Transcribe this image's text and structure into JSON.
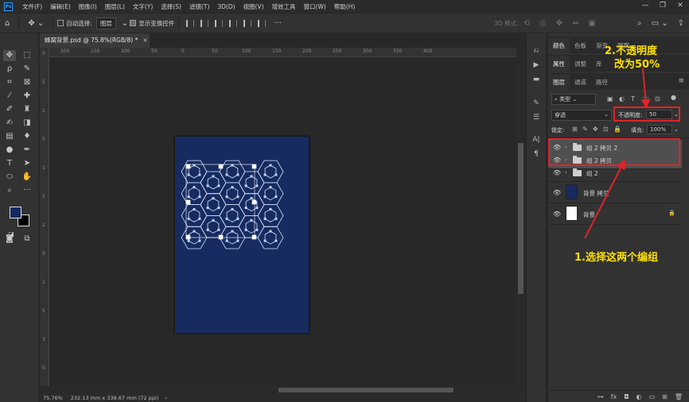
{
  "app": {
    "logo": "Ps"
  },
  "menubar": {
    "items": [
      "文件(F)",
      "编辑(E)",
      "图像(I)",
      "图层(L)",
      "文字(Y)",
      "选择(S)",
      "滤镜(T)",
      "3D(D)",
      "视图(V)",
      "增效工具",
      "窗口(W)",
      "帮助(H)"
    ],
    "window_controls": [
      "—",
      "❐",
      "✕"
    ]
  },
  "options": {
    "auto_select_label": "自动选择:",
    "auto_select_target": "图层",
    "show_transform_label": "显示变换控件",
    "mode_3d_label": "3D 模式:"
  },
  "document": {
    "tab_title": "蜂窝背景.psd @ 75.8%(RGB/8) *",
    "close": "×",
    "background_color": "#172b60"
  },
  "rulers": {
    "top_ticks": [
      "200",
      "150",
      "100",
      "50",
      "0",
      "50",
      "100",
      "150",
      "200",
      "250",
      "300",
      "350",
      "400"
    ],
    "left_ticks": [
      "0",
      "5",
      "1",
      "0",
      "1",
      "5",
      "2",
      "0",
      "2",
      "5",
      "3",
      "0"
    ]
  },
  "status_bar": {
    "zoom": "75.76%",
    "info": "232.13 mm x 338.67 mm (72 ppi)",
    "arrow": "›"
  },
  "panels": {
    "top_tabs": [
      "颜色",
      "色板",
      "渐变",
      "图案"
    ],
    "second_tabs": [
      "属性",
      "调整",
      "库"
    ],
    "layer_tabs": [
      "图层",
      "通道",
      "路径"
    ],
    "filter_kind": "类型",
    "blend_mode": "穿透",
    "opacity_label": "不透明度:",
    "opacity_value": "50",
    "lock_label": "锁定:",
    "fill_label": "填充:",
    "fill_value": "100%",
    "layers": [
      {
        "name": "组 2 拷贝 2",
        "type": "group",
        "selected": true
      },
      {
        "name": "组 2 拷贝",
        "type": "group",
        "selected": true
      },
      {
        "name": "组 2",
        "type": "group",
        "selected": false
      },
      {
        "name": "背景 拷贝",
        "type": "pixel",
        "thumb_color": "#172b60",
        "selected": false
      },
      {
        "name": "背景",
        "type": "pixel",
        "thumb_color": "#ffffff",
        "selected": false,
        "locked": true
      }
    ],
    "bottom_icons": [
      "link-icon",
      "fx-icon",
      "mask-icon",
      "adjustment-icon",
      "group-icon",
      "new-layer-icon",
      "trash-icon"
    ]
  },
  "annotations": {
    "step2_line1": "2.不透明度",
    "step2_line2": "改为50%",
    "step1": "1.选择这两个编组",
    "color": "#e0232b",
    "text_color": "#ffe100"
  }
}
